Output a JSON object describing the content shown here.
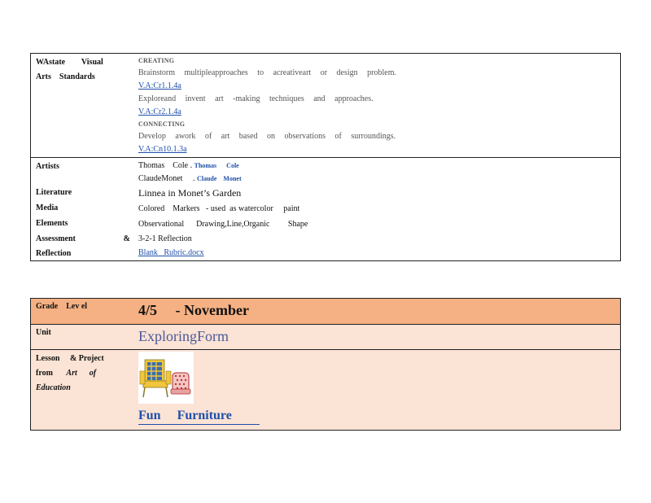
{
  "standards": {
    "label_line1": "WAstate        Visual",
    "label_line2": "Arts    Standards",
    "creating_header": "CREATING",
    "creating_text": "Brainstorm    multipleapproaches     to acreativeart    or design  problem.",
    "creating_link": "V.A:Cr1.1.4a",
    "explore_text": "Exploreand    invent  art  -making  techniques    and  approaches.",
    "explore_link": "V.A:Cr2.1.4a",
    "connecting_header": "CONNECTING",
    "connecting_text": "Develop   awork   of  art  based   on  observations     of  surroundings.",
    "connecting_link": "V.A:Cn10.1.3a"
  },
  "details": {
    "artists_label": "Artists",
    "artist1_name": "Thomas    Cole .",
    "artist1_link": "Thomas      Cole",
    "artist2_name": "ClaudeMonet     .",
    "artist2_link": "Claude    Monet",
    "literature_label": "Literature",
    "literature_value": "Linnea in Monet’s Garden",
    "media_label": "Media",
    "media_value": "Colored    Markers   - used  as watercolor     paint",
    "elements_label": "Elements",
    "elements_value": "Observational      Drawing,Line,Organic         Shape",
    "assessment_label": "Assessment",
    "assessment_amp": "&",
    "reflection_label": "Reflection",
    "assessment_value": "3-2-1 Reflection",
    "rubric_link": "Blank   Rubric.docx"
  },
  "grade": {
    "label": "Grade    Lev el",
    "value": "4/5     - November",
    "unit_label": "Unit",
    "unit_value": "ExploringForm",
    "lesson_label_line1": "Lesson     & Project",
    "lesson_label_from": "from",
    "lesson_label_art": "Art      of",
    "lesson_label_edu": "Education",
    "project_link": "Fun     Furniture"
  },
  "colors": {
    "header_bg": "#f5b183",
    "body_bg": "#fbe3d5",
    "link": "#1f4fa8"
  }
}
